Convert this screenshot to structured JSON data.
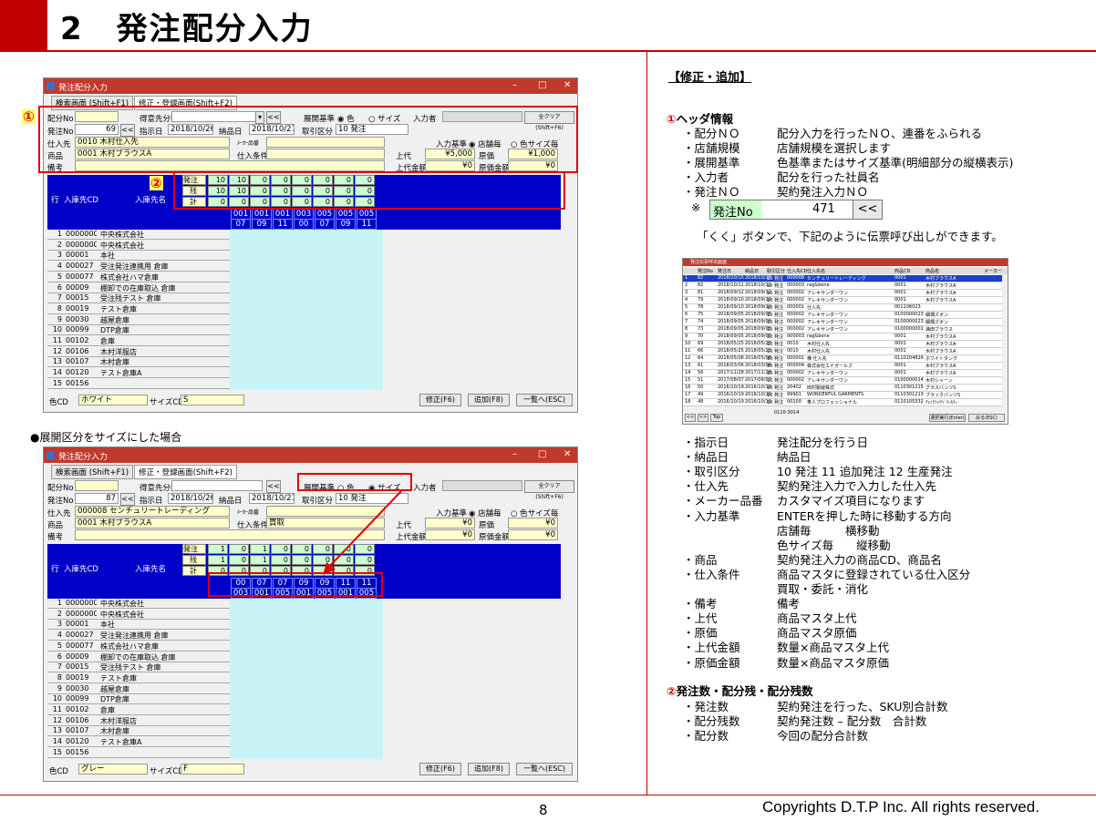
{
  "page": {
    "section_number": "2",
    "title": "発注配分入力",
    "page_number": "8",
    "copyright": "Copyrights  D.T.P Inc. All rights reserved."
  },
  "win1": {
    "title": "発注配分入力",
    "tab1": "検索画面 (Shift+F1)",
    "tab2": "修正・登録画面(Shift+F2)",
    "haibun_no_label": "配分No",
    "tokui_label": "得意先分類",
    "tenkai_label": "展開基準",
    "iro": "色",
    "size": "サイズ",
    "nyuryoku_label": "入力者",
    "all_clear": "全クリア(Shift+F6)",
    "hachu_no_label": "発注No",
    "hachu_no": "69",
    "back_btn": "<<",
    "shiji_label": "指示日",
    "shiji": "2018/10/26",
    "nohin_label": "納品日",
    "nohin": "2018/10/27",
    "torihiki_label": "取引区分",
    "torihiki": "10 発注",
    "shiire_label": "仕入先",
    "shiire": "0010 木村仕入先",
    "maker_label": "ﾒｰｶｰ品番",
    "kijun_label": "入力基準",
    "tenpo": "店舗毎",
    "iro_size": "色サイズ毎",
    "shohin_label": "商品",
    "shohin": "0001 木村ブラウスA",
    "joken_label": "仕入条件",
    "joken": "",
    "jodai_label": "上代",
    "jodai": "¥5,000",
    "genka_label": "原価",
    "genka": "¥1,000",
    "biko_label": "備考",
    "jodai_kin_label": "上代金額",
    "jodai_kin": "¥0",
    "genka_kin_label": "原価金額",
    "genka_kin": "¥0",
    "hachusu_label": "発注数",
    "zan_label": "残",
    "kei_label": "計",
    "gyo": "行",
    "nyuko_cd": "入庫先CD",
    "nyuko_name": "入庫先名",
    "hachusu": [
      "10",
      "10",
      "0",
      "0",
      "0",
      "0",
      "0",
      "0"
    ],
    "zan": [
      "10",
      "10",
      "0",
      "0",
      "0",
      "0",
      "0",
      "0"
    ],
    "kei": [
      "0",
      "0",
      "0",
      "0",
      "0",
      "0",
      "0",
      "0"
    ],
    "head1": [
      "001",
      "001",
      "001",
      "003",
      "005",
      "005",
      "005"
    ],
    "head2": [
      "07",
      "09",
      "11",
      "00",
      "07",
      "09",
      "11"
    ],
    "rows": [
      [
        "1",
        "0000000",
        "中央株式会社"
      ],
      [
        "2",
        "0000000",
        "中央株式会社"
      ],
      [
        "3",
        "00001",
        "本社"
      ],
      [
        "4",
        "000027",
        "受注発注連携用 倉庫"
      ],
      [
        "5",
        "000077",
        "株式会社ハマ倉庫"
      ],
      [
        "6",
        "00009",
        "棚卸での在庫取込 倉庫"
      ],
      [
        "7",
        "00015",
        "受注残テスト 倉庫"
      ],
      [
        "8",
        "00019",
        "テスト倉庫"
      ],
      [
        "9",
        "00030",
        "越屋倉庫"
      ],
      [
        "10",
        "00099",
        "DTP倉庫"
      ],
      [
        "11",
        "00102",
        "倉庫"
      ],
      [
        "12",
        "00106",
        "木村洋服店"
      ],
      [
        "13",
        "00107",
        "木村倉庫"
      ],
      [
        "14",
        "00120",
        "テスト倉庫A"
      ],
      [
        "15",
        "00156",
        ""
      ]
    ],
    "iro_cd_label": "色CD",
    "iro_cd": "ホワイト",
    "size_cd_label": "サイズCD",
    "size_cd": "S",
    "shusei": "修正(F6)",
    "tsuika": "追加(F8)",
    "ichiran": "一覧へ(ESC)"
  },
  "caption2": "●展開区分をサイズにした場合",
  "win2": {
    "title": "発注配分入力",
    "hachu_no": "87",
    "shiji": "2018/10/26",
    "nohin": "2018/10/27",
    "torihiki": "10 発注",
    "shiire": "000008 センチュリートレーディング",
    "shohin": "0001 木村ブラウスA",
    "joken": "買取",
    "jodai": "¥0",
    "genka": "¥0",
    "jodai_kin": "¥0",
    "genka_kin": "¥0",
    "hachusu": [
      "1",
      "0",
      "1",
      "0",
      "0",
      "0",
      "0",
      "0"
    ],
    "zan": [
      "1",
      "0",
      "1",
      "0",
      "0",
      "0",
      "0",
      "0"
    ],
    "kei": [
      "0",
      "0",
      "0",
      "0",
      "0",
      "0",
      "0",
      "0"
    ],
    "head1": [
      "00",
      "07",
      "07",
      "09",
      "09",
      "11",
      "11"
    ],
    "head2": [
      "003",
      "001",
      "005",
      "001",
      "005",
      "001",
      "005"
    ],
    "iro_cd": "グレー",
    "size_cd": "F"
  },
  "right": {
    "heading": "【修正・追加】",
    "sec1": "ヘッダ情報",
    "sec1_num": "①",
    "items1": [
      [
        "・配分ＮＯ",
        "配分入力を行ったＮＯ、連番をふられる"
      ],
      [
        "・店舗規模",
        "店舗規模を選択します"
      ],
      [
        "・展開基準",
        "色基準またはサイズ基準(明細部分の縦横表示)"
      ],
      [
        "・入力者",
        "配分を行った社員名"
      ],
      [
        "・発注ＮＯ",
        "契約発注入力ＮＯ"
      ]
    ],
    "note_mark": "※",
    "hachu_box_label": "発注No",
    "hachu_box_val": "471",
    "hachu_box_btn": "<<",
    "note": "「くく」ボタンで、下記のように伝票呼び出しができます。",
    "items2": [
      [
        "・指示日",
        "発注配分を行う日"
      ],
      [
        "・納品日",
        "納品日"
      ],
      [
        "・取引区分",
        "10 発注 11 追加発注 12 生産発注"
      ],
      [
        "・仕入先",
        "契約発注入力で入力した仕入先"
      ],
      [
        "・メーカー品番",
        "カスタマイズ項目になります"
      ],
      [
        "・入力基準",
        "ENTERを押した時に移動する方向"
      ],
      [
        "",
        "店舗毎　　　横移動"
      ],
      [
        "",
        "色サイズ毎　　縦移動"
      ],
      [
        "・商品",
        "契約発注入力の商品CD、商品名"
      ],
      [
        "・仕入条件",
        "商品マスタに登録されている仕入区分"
      ],
      [
        "",
        "買取・委託・消化"
      ],
      [
        "・備考",
        "備考"
      ],
      [
        "・上代",
        "商品マスタ上代"
      ],
      [
        "・原価",
        "商品マスタ原価"
      ],
      [
        "・上代金額",
        "数量×商品マスタ上代"
      ],
      [
        "・原価金額",
        "数量×商品マスタ原価"
      ]
    ],
    "sec2": "発注数・配分残・配分残数",
    "sec2_num": "②",
    "items3": [
      [
        "・発注数",
        "契約発注を行った、SKU別合計数"
      ],
      [
        "・配分残数",
        "契約発注数 – 配分数　合計数"
      ],
      [
        "・配分数",
        "今回の配分合計数"
      ]
    ]
  },
  "popup": {
    "title": "発注伝票呼出画面",
    "headers": [
      "",
      "発注No",
      "発注日",
      "納品日",
      "取引区分",
      "仕入先CD",
      "仕入先名",
      "商品CD",
      "商品名",
      "メーカー"
    ],
    "rows": [
      [
        "1",
        "82",
        "2018/10/15",
        "2018/10/15",
        "10 発注",
        "000008",
        "センチュリートレーディング",
        "0001",
        "木村ブラウスA"
      ],
      [
        "2",
        "82",
        "2018/10/11",
        "2018/10/11",
        "10 発注",
        "000003",
        "rag&bone",
        "0001",
        "木村ブラウスA"
      ],
      [
        "3",
        "81",
        "2018/09/12",
        "2018/09/12",
        "10 発注",
        "000002",
        "アレキサンダーワン",
        "0001",
        "木村ブラウスA"
      ],
      [
        "4",
        "79",
        "2018/09/10",
        "2018/09/10",
        "10 発注",
        "000002",
        "アレキサンダーワン",
        "0001",
        "木村ブラウスA"
      ],
      [
        "5",
        "78",
        "2018/09/10",
        "2018/09/10",
        "10 発注",
        "000001",
        "仕入先",
        "001106023",
        ""
      ],
      [
        "6",
        "75",
        "2018/09/05",
        "2018/09/05",
        "10 発注",
        "000002",
        "アレキサンダーワン",
        "0100000023",
        "細畑ズボン"
      ],
      [
        "7",
        "74",
        "2018/09/05",
        "2018/09/05",
        "10 発注",
        "000002",
        "アレキサンダーワン",
        "0100000023",
        "細畑ズボン"
      ],
      [
        "8",
        "73",
        "2018/09/05",
        "2018/09/05",
        "10 発注",
        "000002",
        "アレキサンダーワン",
        "0100000001",
        "満田ブラウス"
      ],
      [
        "9",
        "70",
        "2018/09/05",
        "2018/09/05",
        "10 発注",
        "000003",
        "rag&bone",
        "0001",
        "木村ブラウスA"
      ],
      [
        "10",
        "69",
        "2018/05/25",
        "2018/05/25",
        "10 発注",
        "0010",
        "木村仕入先",
        "0001",
        "木村ブラウスA"
      ],
      [
        "11",
        "66",
        "2018/05/25",
        "2018/05/25",
        "10 発注",
        "0010",
        "木村仕入先",
        "0001",
        "木村ブラウスA"
      ],
      [
        "12",
        "64",
        "2018/05/08",
        "2018/05/08",
        "10 発注",
        "000001",
        "横 仕入先",
        "0110204826",
        "ホワイトタンク"
      ],
      [
        "13",
        "61",
        "2018/03/06",
        "2018/03/06",
        "10 発注",
        "000004",
        "株式会社エイガールズ",
        "0001",
        "木村ブラウスA"
      ],
      [
        "14",
        "56",
        "2017/11/28",
        "2017/11/28",
        "10 発注",
        "000002",
        "アレキサンダーワン",
        "0001",
        "木村ブラウスA"
      ],
      [
        "15",
        "51",
        "2017/08/07",
        "2017/08/07",
        "10 発注",
        "000002",
        "アレキサンダーワン",
        "0100000014",
        "木村シャーン"
      ],
      [
        "16",
        "50",
        "2016/10/19",
        "2016/10/19",
        "10 発注",
        "20402",
        "田村製縫株式",
        "0110301215",
        "グラスパンツS"
      ],
      [
        "17",
        "49",
        "2016/10/19",
        "2016/10/19",
        "10 発注",
        "99901",
        "WONDERFUL GARMENTS",
        "0110301213",
        "ブラックパンツS"
      ],
      [
        "18",
        "48",
        "2016/10/19",
        "2016/10/19",
        "10 発注",
        "00100",
        "帯人プロフェッショナル",
        "0110105332",
        "ﾁｪｯｸｼｬﾂﾍﾞﾘｰｶﾗｰ"
      ]
    ],
    "extra_code": "0110-3014",
    "btn_prev": "<<",
    "btn_next": ">>",
    "btn_top": "Top",
    "btn_sel": "選択実行(Enter)",
    "btn_esc": "戻る(ESC)"
  }
}
